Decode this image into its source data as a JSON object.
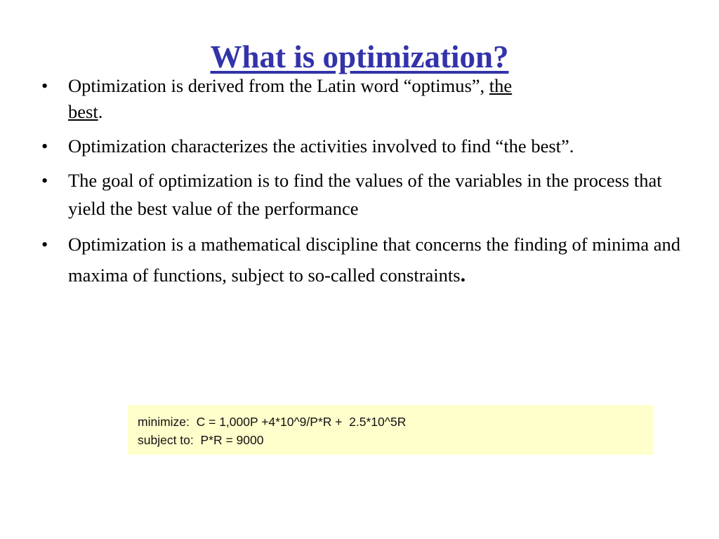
{
  "slide": {
    "title": "What is optimization?",
    "title_color": "#3333AA",
    "background_color": "#FFFFFF",
    "text_color": "#000000",
    "bullet_marker": "•",
    "bullets": [
      {
        "id": "bullet-latin-origin",
        "line1": "Optimization is derived from the Latin word “optimus”, ",
        "underlined_1": "the",
        "line2_underlined": "best",
        "line2_tail": "."
      },
      {
        "id": "bullet-characterizes",
        "text": "Optimization characterizes the activities involved to find “the best”."
      },
      {
        "id": "bullet-goal",
        "text": "The goal of optimization is to find the values of the variables in the process that yield the best value of the performance"
      },
      {
        "id": "bullet-discipline",
        "text_main": "Optimization is a mathematical discipline that concerns the finding of minima and maxima of functions, subject to so-called constraints",
        "text_period": "."
      }
    ]
  },
  "equation_box": {
    "background_color": "#FFFFCC",
    "line1": "minimize:  C = 1,000P +4*10^9/P*R +  2.5*10^5R",
    "line2": "subject to:  P*R = 9000"
  }
}
